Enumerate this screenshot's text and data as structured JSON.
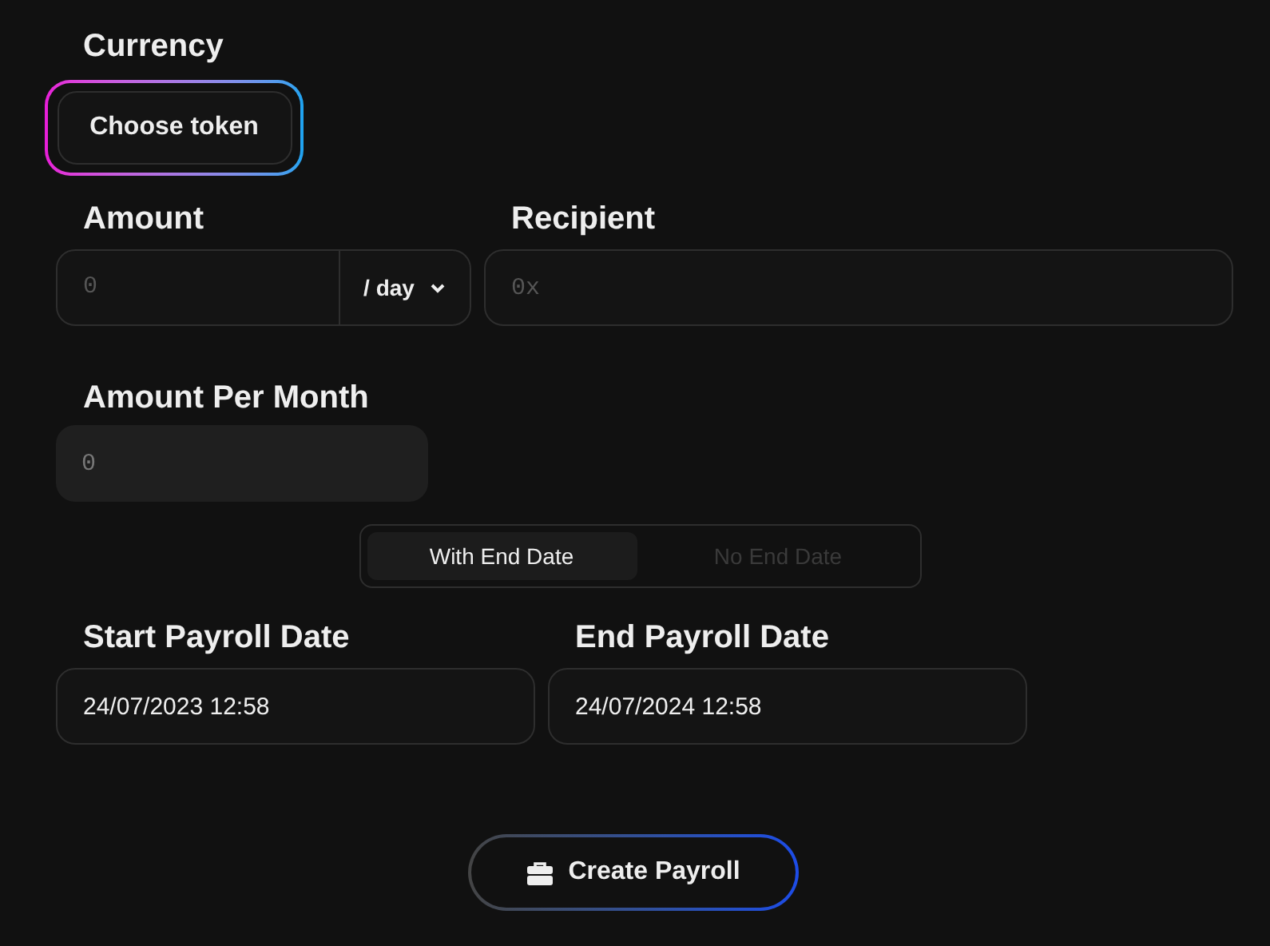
{
  "currency": {
    "label": "Currency",
    "button": "Choose token"
  },
  "amount": {
    "label": "Amount",
    "placeholder": "0",
    "period": "/ day"
  },
  "recipient": {
    "label": "Recipient",
    "placeholder": "0x"
  },
  "amount_per_month": {
    "label": "Amount Per Month",
    "placeholder": "0"
  },
  "end_date_toggle": [
    {
      "label": "With End Date",
      "selected": true
    },
    {
      "label": "No End Date",
      "selected": false
    }
  ],
  "start_date": {
    "label": "Start Payroll Date",
    "value": "24/07/2023 12:58"
  },
  "end_date": {
    "label": "End Payroll Date",
    "value": "24/07/2024 12:58"
  },
  "submit": {
    "label": "Create Payroll"
  }
}
